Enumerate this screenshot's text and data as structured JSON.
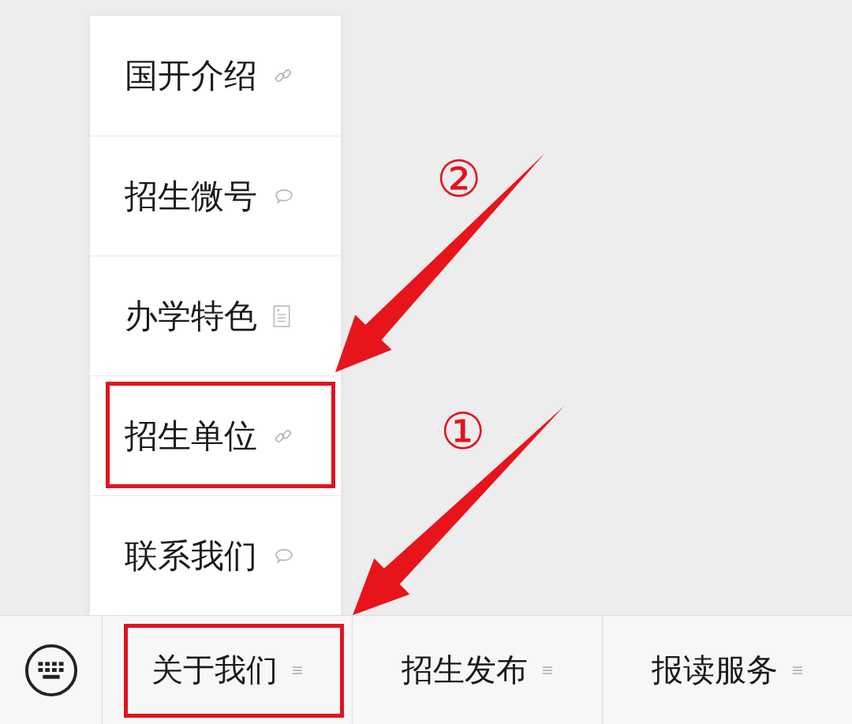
{
  "menu": {
    "items": [
      {
        "label": "国开介绍",
        "kind": "link",
        "annotated": false
      },
      {
        "label": "招生微号",
        "kind": "chat",
        "annotated": false
      },
      {
        "label": "办学特色",
        "kind": "article",
        "annotated": false
      },
      {
        "label": "招生单位",
        "kind": "link",
        "annotated": true
      },
      {
        "label": "联系我们",
        "kind": "chat",
        "annotated": false
      }
    ]
  },
  "bottom_bar": {
    "tabs": [
      {
        "label": "关于我们",
        "annotated": true
      },
      {
        "label": "招生发布",
        "annotated": false
      },
      {
        "label": "报读服务",
        "annotated": false
      }
    ]
  },
  "annotations": [
    {
      "label": "②"
    },
    {
      "label": "①"
    }
  ]
}
